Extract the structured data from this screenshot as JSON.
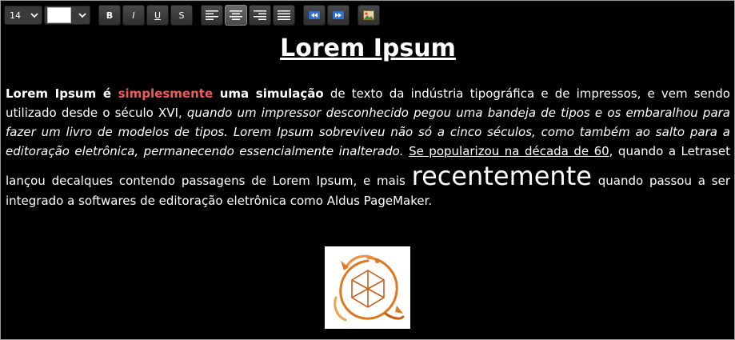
{
  "toolbar": {
    "font_size": {
      "value": "14"
    },
    "color_picker": {
      "selected_color": "#ffffff"
    },
    "format_buttons": {
      "bold": "B",
      "italic": "I",
      "underline": "U",
      "strikethrough": "S"
    },
    "align_buttons": {
      "active": "center"
    }
  },
  "content": {
    "title": "Lorem Ipsum",
    "paragraph": {
      "p1_bold_a": "Lorem Ipsum é ",
      "p1_red": "simplesmente",
      "p1_bold_b": " uma simulação",
      "p1_normal": " de texto da indústria tipográfica e de impressos, e vem sendo utilizado desde o século XVI, ",
      "p1_italic": "quando um impressor desconhecido pegou uma bandeja de tipos e os embaralhou para fazer um livro de modelos de tipos. Lorem Ipsum sobreviveu não só a cinco séculos, como também ao salto para a editoração eletrônica, permanecendo essencialmente inalterado.",
      "p1_space": " ",
      "p1_underline": "Se popularizou na década de 60",
      "p1_tail": ", quando a Letraset lançou decalques contendo passagens de Lorem Ipsum, e mais ",
      "p1_big": "recentemente",
      "p1_end": " quando passou a ser integrado a softwares de editoração eletrônica como Aldus PageMaker."
    },
    "image": {
      "icon": "dragon-dice-logo-icon"
    }
  },
  "colors": {
    "background": "#000000",
    "text": "#ffffff",
    "accent_red": "#f05a5a",
    "logo_orange": "#e07820"
  }
}
